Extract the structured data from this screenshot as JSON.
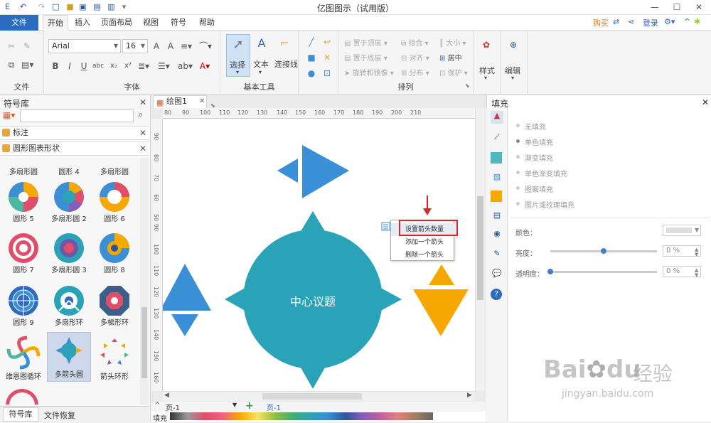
{
  "title_bar": {
    "title": "亿图图示（试用版）",
    "min": "—",
    "max": "☐",
    "close": "✕"
  },
  "menu": {
    "file": "文件",
    "tabs": [
      "开始",
      "插入",
      "页面布局",
      "视图",
      "符号",
      "帮助"
    ],
    "buy": "购买",
    "login": "登录"
  },
  "ribbon": {
    "file_group": "文件",
    "font_group": "字体",
    "font_name": "Arial",
    "font_size": "16",
    "basic_tools_group": "基本工具",
    "select": "选择",
    "text": "文本",
    "connector": "连接线",
    "arrange_group": "排列",
    "bring_front": "置于顶层",
    "send_back": "置于底层",
    "rotate_mirror": "旋转和镜像",
    "group": "组合",
    "align": "对齐",
    "distribute": "分布",
    "size": "大小",
    "center": "居中",
    "protect": "保护",
    "style": "样式",
    "edit": "编辑"
  },
  "left_panel": {
    "title": "符号库",
    "search_placeholder": "",
    "lib1": "标注",
    "lib2": "圆形图表形状",
    "shapes": [
      "多扇形圆",
      "圆形 4",
      "多扇形圆",
      "圆形 5",
      "多扇形圆 2",
      "圆形 6",
      "圆形 7",
      "多扇形圆 3",
      "圆形 8",
      "圆形 9",
      "多扇形环",
      "多梯形环",
      "维恩图循环",
      "多箭头圆",
      "箭头环形"
    ],
    "bottom_tabs": [
      "符号库",
      "文件恢复"
    ]
  },
  "canvas": {
    "doc_tab": "绘图1",
    "h_ruler": [
      "80",
      "90",
      "100",
      "110",
      "120",
      "130",
      "140",
      "150",
      "160",
      "170",
      "180",
      "190",
      "200",
      "210"
    ],
    "v_ruler": [
      "90",
      "80",
      "70",
      "60",
      "50",
      "90",
      "100",
      "110",
      "120",
      "130",
      "140",
      "150",
      "160"
    ],
    "center_text": "中心议题",
    "context_menu": [
      "设置箭头数量",
      "添加一个箭头",
      "删除一个箭头"
    ],
    "page_select": "页-1",
    "page_tab": "页-1",
    "fill_label": "填充"
  },
  "right_panel": {
    "title": "填充",
    "options": [
      "无填充",
      "单色填充",
      "渐变填充",
      "单色渐变填充",
      "图案填充",
      "图片或纹理填充"
    ],
    "color_label": "颜色：",
    "brightness_label": "亮度：",
    "transparency_label": "透明度：",
    "brightness_value": "0 %",
    "transparency_value": "0 %",
    "brightness_pct": 50,
    "transparency_pct": 0
  },
  "watermark": {
    "brand": "Bai",
    "brand2": "du",
    "brand3": "经验",
    "url": "jingyan.baidu.com"
  },
  "colors": {
    "accent": "#2b6bc0",
    "teal": "#2aa3b8",
    "blue": "#3a8fd6",
    "orange": "#f7a800",
    "red": "#d8262a"
  }
}
